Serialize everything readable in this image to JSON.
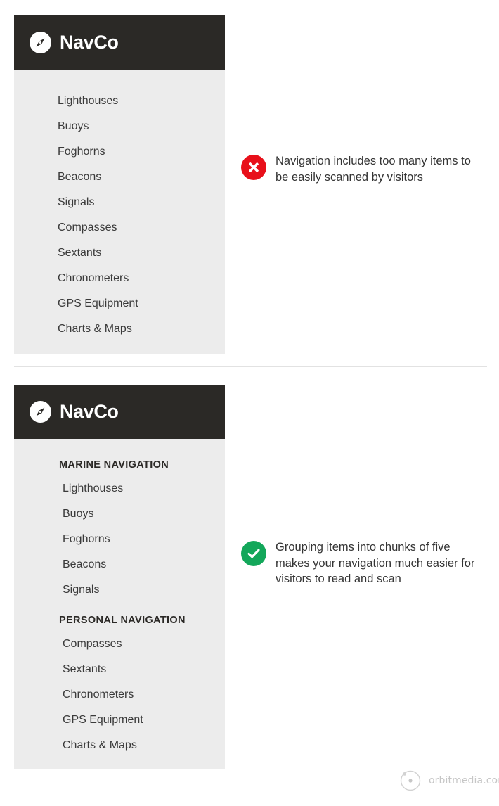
{
  "colors": {
    "header_bg": "#2b2926",
    "panel_bg": "#ececec",
    "page_bg": "#ffffff",
    "bad_badge": "#e8101a",
    "good_badge": "#13a75a",
    "item_text": "#3a3a3a",
    "divider": "#e2e2e2",
    "watermark": "#c6c6c6"
  },
  "brand": {
    "name": "NavCo",
    "logo_icon": "compass-icon"
  },
  "bad_example": {
    "nav_items": [
      "Lighthouses",
      "Buoys",
      "Foghorns",
      "Beacons",
      "Signals",
      "Compasses",
      "Sextants",
      "Chronometers",
      "GPS Equipment",
      "Charts & Maps"
    ],
    "annotation": {
      "icon": "x-circle-icon",
      "text": "Navigation includes too many items to be easily scanned by visitors"
    }
  },
  "good_example": {
    "groups": [
      {
        "label": "MARINE NAVIGATION",
        "items": [
          "Lighthouses",
          "Buoys",
          "Foghorns",
          "Beacons",
          "Signals"
        ]
      },
      {
        "label": "PERSONAL NAVIGATION",
        "items": [
          "Compasses",
          "Sextants",
          "Chronometers",
          "GPS Equipment",
          "Charts & Maps"
        ]
      }
    ],
    "annotation": {
      "icon": "check-circle-icon",
      "text": "Grouping items into chunks of five makes your navigation much easier for visitors to read and scan"
    }
  },
  "watermark": {
    "icon": "orbit-icon",
    "text": "orbitmedia.com"
  }
}
